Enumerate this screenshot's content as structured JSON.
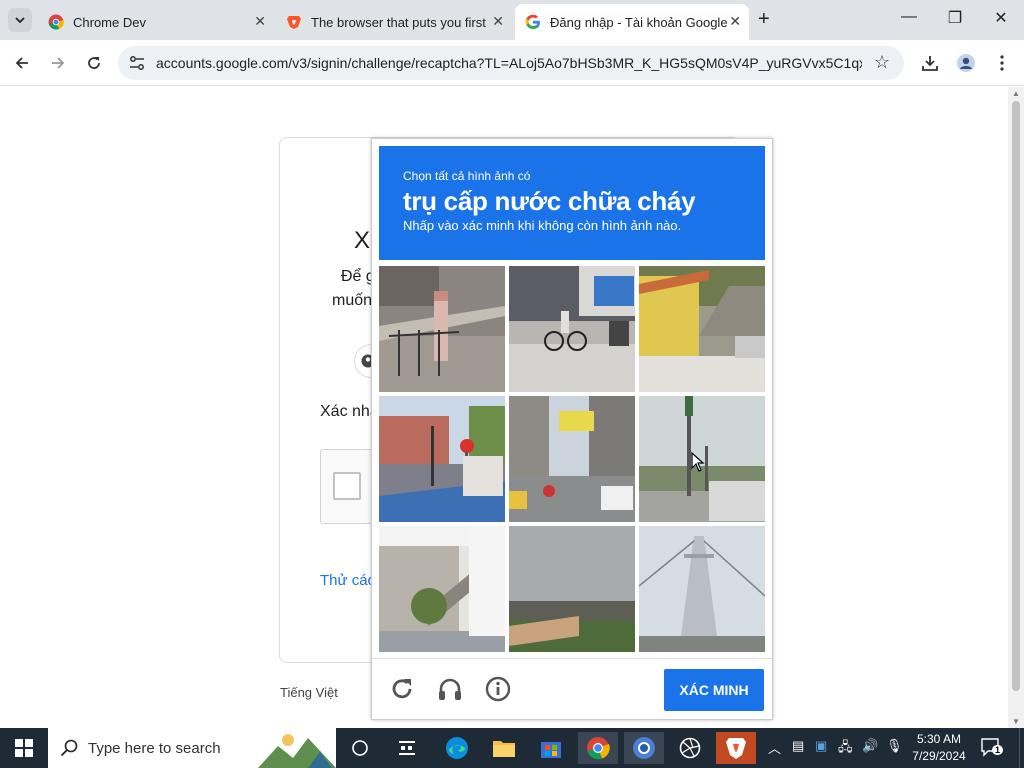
{
  "browser": {
    "tabs": [
      {
        "title": "Chrome Dev"
      },
      {
        "title": "The browser that puts you first"
      },
      {
        "title": "Đăng nhập - Tài khoản Google"
      }
    ],
    "url": "accounts.google.com/v3/signin/challenge/recaptcha?TL=ALoj5Ao7bHSb3MR_K_HG5sQM0sV4P_yuRGVvx5C1qxj..."
  },
  "signin": {
    "heading_fragment": "X",
    "line1_fragment": "Để g",
    "line2_fragment": "muốn",
    "confirm_fragment": "Xác nhậ",
    "try_other_fragment": "Thử các",
    "language": "Tiếng Việt"
  },
  "captcha": {
    "instruction_small": "Chọn tất cả hình ảnh có",
    "target": "trụ cấp nước chữa cháy",
    "instruction_hint": "Nhấp vào xác minh khi không còn hình ảnh nào.",
    "verify_label": "XÁC MINH",
    "colors": {
      "header": "#1a73e8",
      "button": "#1a73e8"
    }
  },
  "taskbar": {
    "search_placeholder": "Type here to search",
    "time": "5:30 AM",
    "date": "7/29/2024",
    "notification_count": "1"
  }
}
